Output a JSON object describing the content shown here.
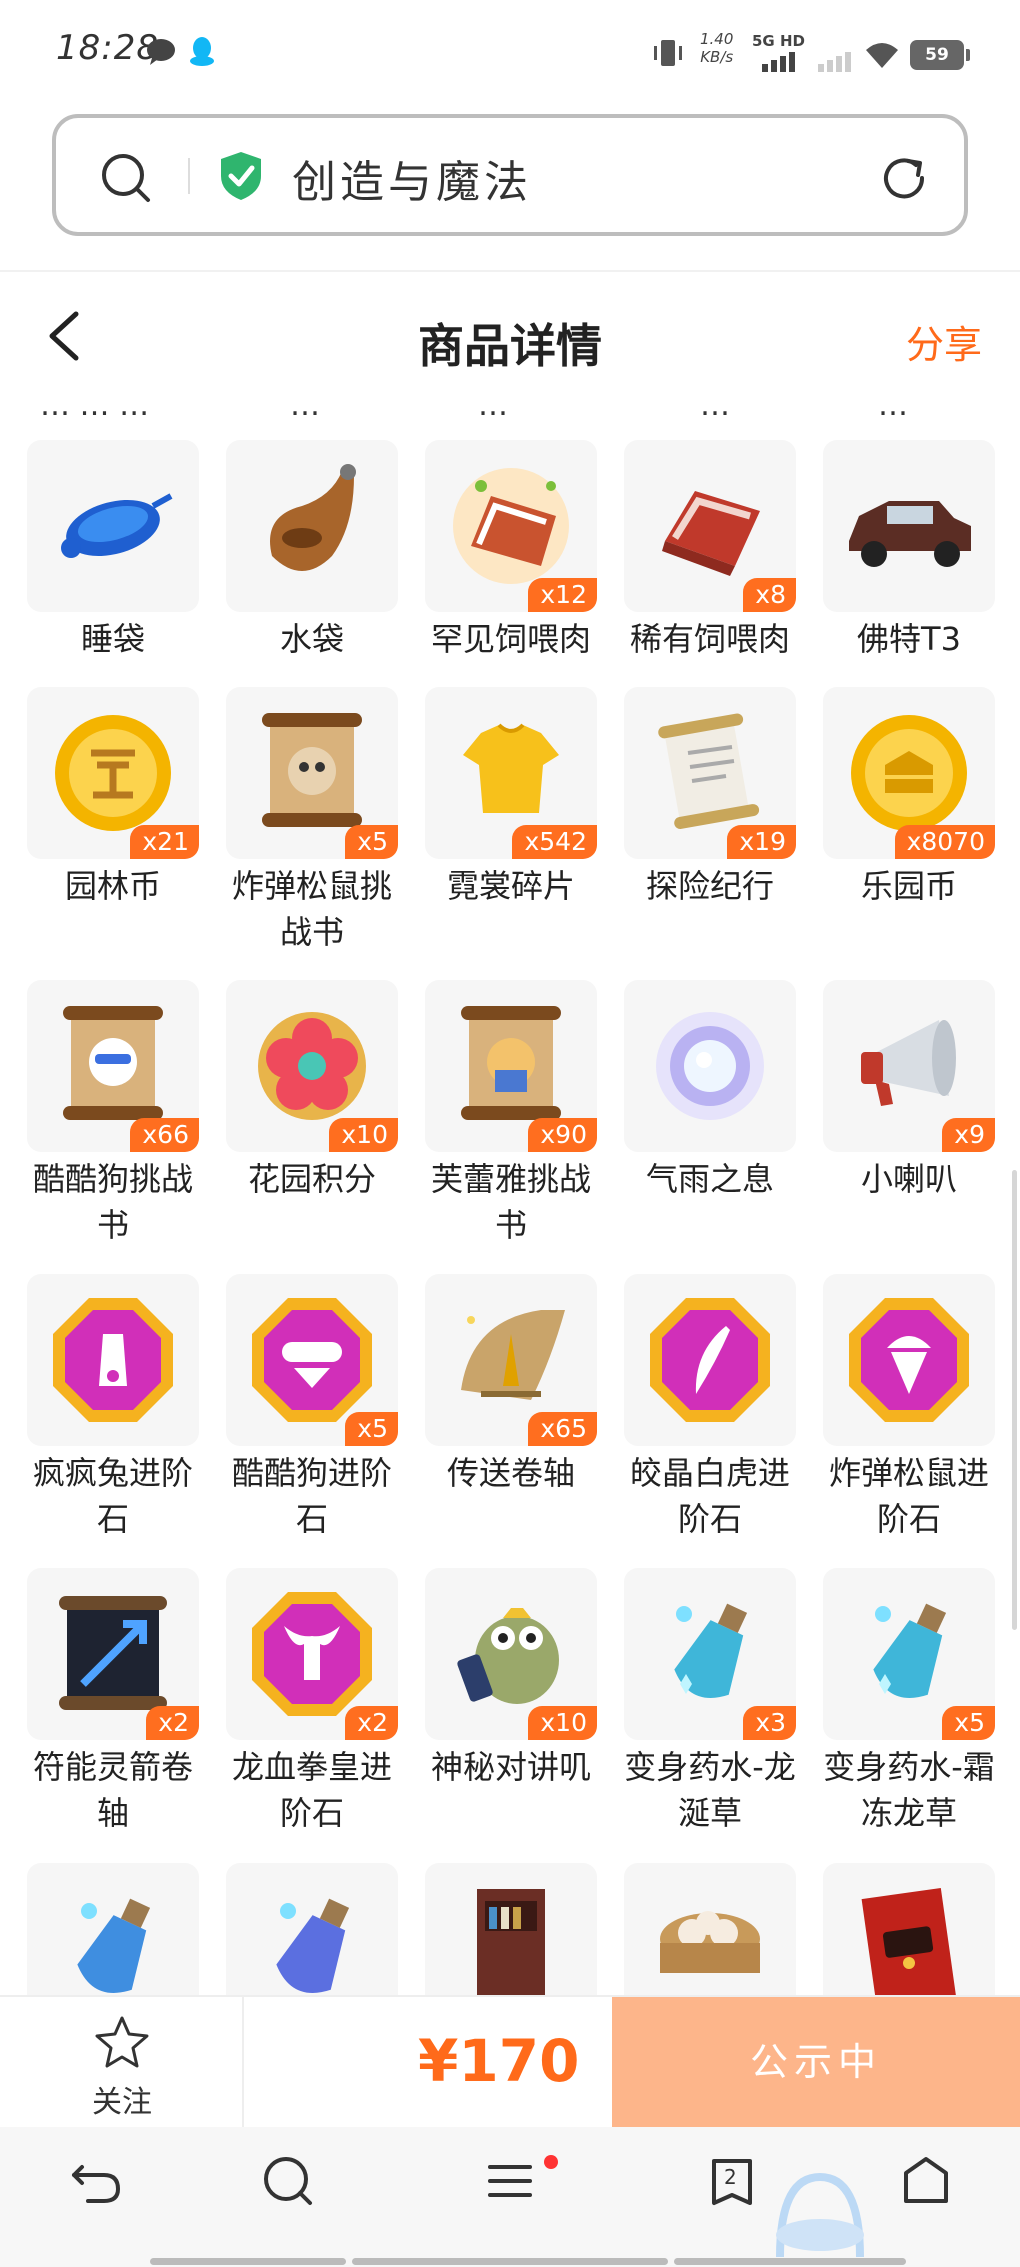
{
  "status_bar": {
    "time": "18:28",
    "speed_value": "1.40",
    "speed_unit": "KB/s",
    "network": "5G HD",
    "battery": "59"
  },
  "browser": {
    "search_title": "创造与魔法"
  },
  "header": {
    "title": "商品详情",
    "share": "分享"
  },
  "items": [
    {
      "name": "睡袋",
      "count": "",
      "icon": "sleeping-bag-icon"
    },
    {
      "name": "水袋",
      "count": "",
      "icon": "water-bag-icon"
    },
    {
      "name": "罕见饲喂肉",
      "count": "x12",
      "icon": "rare-feed-meat-icon"
    },
    {
      "name": "稀有饲喂肉",
      "count": "x8",
      "icon": "scarce-feed-meat-icon"
    },
    {
      "name": "佛特T3",
      "count": "",
      "icon": "vintage-car-icon"
    },
    {
      "name": "园林币",
      "count": "x21",
      "icon": "garden-coin-icon"
    },
    {
      "name": "炸弹松鼠挑战书",
      "count": "x5",
      "icon": "wanted-scroll-icon"
    },
    {
      "name": "霓裳碎片",
      "count": "x542",
      "icon": "shirt-fragment-icon"
    },
    {
      "name": "探险纪行",
      "count": "x19",
      "icon": "paper-scroll-icon"
    },
    {
      "name": "乐园币",
      "count": "x8070",
      "icon": "park-coin-icon"
    },
    {
      "name": "酷酷狗挑战书",
      "count": "x66",
      "icon": "wanted-scroll-icon"
    },
    {
      "name": "花园积分",
      "count": "x10",
      "icon": "flower-badge-icon"
    },
    {
      "name": "芙蕾雅挑战书",
      "count": "x90",
      "icon": "wanted-scroll-icon"
    },
    {
      "name": "气雨之息",
      "count": "",
      "icon": "glowing-orb-icon"
    },
    {
      "name": "小喇叭",
      "count": "x9",
      "icon": "megaphone-icon"
    },
    {
      "name": "疯疯兔进阶石",
      "count": "",
      "icon": "gem-rabbit-icon"
    },
    {
      "name": "酷酷狗进阶石",
      "count": "x5",
      "icon": "gem-dog-icon"
    },
    {
      "name": "传送卷轴",
      "count": "x65",
      "icon": "teleport-scroll-icon"
    },
    {
      "name": "皎晶白虎进阶石",
      "count": "",
      "icon": "gem-tiger-icon"
    },
    {
      "name": "炸弹松鼠进阶石",
      "count": "",
      "icon": "gem-squirrel-icon"
    },
    {
      "name": "符能灵箭卷轴",
      "count": "x2",
      "icon": "arrow-scroll-icon"
    },
    {
      "name": "龙血拳皇进阶石",
      "count": "x2",
      "icon": "gem-bull-icon"
    },
    {
      "name": "神秘对讲叽",
      "count": "x10",
      "icon": "walkie-bird-icon"
    },
    {
      "name": "变身药水-龙涎草",
      "count": "x3",
      "icon": "potion-icon"
    },
    {
      "name": "变身药水-霜冻龙草",
      "count": "x5",
      "icon": "potion-icon"
    },
    {
      "name": "",
      "count": "",
      "icon": "potion-icon"
    },
    {
      "name": "",
      "count": "",
      "icon": "potion-icon"
    },
    {
      "name": "",
      "count": "",
      "icon": "bookshelf-icon"
    },
    {
      "name": "",
      "count": "",
      "icon": "dumpling-basket-icon"
    },
    {
      "name": "",
      "count": "",
      "icon": "red-envelope-icon"
    }
  ],
  "action_bar": {
    "follow_label": "关注",
    "price": "¥170",
    "status_button": "公示中"
  },
  "toolbar": {
    "tabs_count": "2"
  }
}
